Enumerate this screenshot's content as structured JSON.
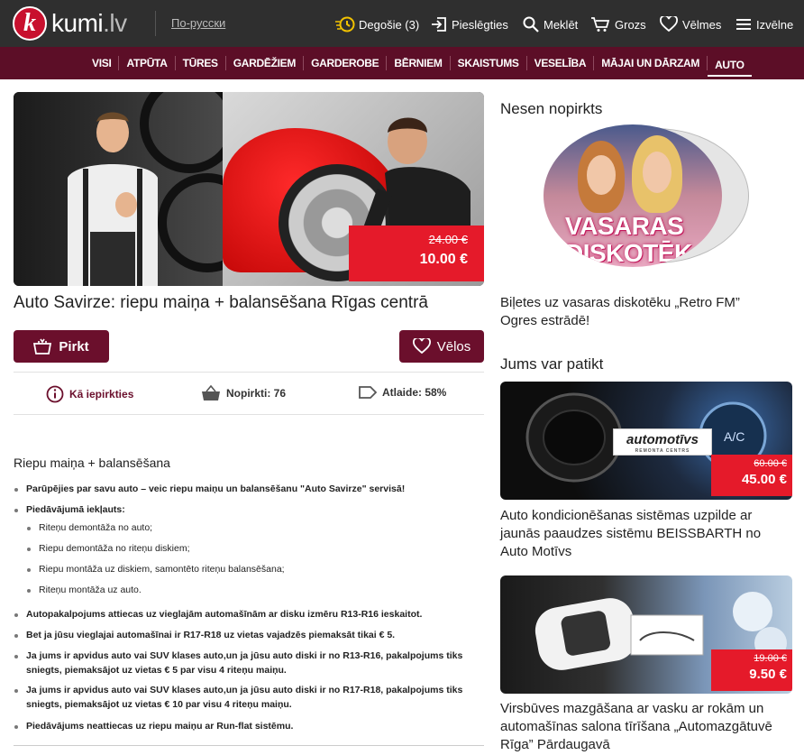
{
  "header": {
    "logo_letter": "k",
    "logo_name": "kumi",
    "logo_tld": ".lv",
    "lang_link": "По-русски",
    "deals_label": "Degošie (3)",
    "login_label": "Pieslēgties",
    "search_label": "Meklēt",
    "cart_label": "Grozs",
    "wishlist_label": "Vēlmes",
    "menu_label": "Izvēlne"
  },
  "nav": {
    "items": [
      "VISI",
      "ATPŪTA",
      "TŪRES",
      "GARDĒŽIEM",
      "GARDEROBE",
      "BĒRNIEM",
      "SKAISTUMS",
      "VESELĪBA",
      "MĀJAI UN DĀRZAM",
      "AUTO"
    ],
    "active": "AUTO"
  },
  "deal": {
    "old_price": "24.00 €",
    "new_price": "10.00 €",
    "title": "Auto Savirze: riepu maiņa + balansēšana Rīgas centrā",
    "buy_label": "Pirkt",
    "wish_label": "Vēlos",
    "how_label": "Kā iepirkties",
    "bought_label": "Nopirkti: 76",
    "discount_label": "Atlaide: 58%"
  },
  "description": {
    "heading": "Riepu maiņa + balansēšana",
    "p1": "Parūpējies par savu auto – veic riepu maiņu un balansēšanu \"Auto Savirze\" servisā!",
    "p2": "Piedāvājumā iekļauts:",
    "s1": "Riteņu demontāža no auto;",
    "s2": "Riepu demontāža no riteņu diskiem;",
    "s3": "Riepu montāža uz diskiem, samontēto riteņu balansēšana;",
    "s4": "Riteņu montāža uz auto.",
    "p3": "Autopakalpojums attiecas uz vieglajām automašīnām ar disku izmēru R13-R16 ieskaitot.",
    "p4": "Bet ja jūsu vieglajai automašīnai ir R17-R18 uz vietas vajadzēs piemaksāt tikai € 5.",
    "p5a": "Ja jums ir apvidus auto vai SUV klases auto,un ja jūsu auto diski ir no R13-R16, pakalpojums tiks",
    "p5b": "sniegts, piemaksājot uz vietas € 5 par visu 4 riteņu maiņu.",
    "p6a": "Ja jums ir apvidus auto vai SUV klases auto,un ja jūsu auto diski ir no R17-R18, pakalpojums tiks",
    "p6b": "sniegts, piemaksājot uz vietas € 10 par visu 4 riteņu maiņu.",
    "p7": "Piedāvājums neattiecas uz riepu maiņu ar Run-flat sistēmu."
  },
  "sidebar": {
    "recent_heading": "Nesen nopirkts",
    "recent_img_text1": "VASARAS",
    "recent_img_text2": "DISKOTĒK",
    "recent_title_1": "Biļetes uz vasaras diskotēku „Retro FM”",
    "recent_title_2": "Ogres estrādē!",
    "like_heading": "Jums var patikt",
    "card1": {
      "logo": "automotīvs",
      "logo_sub": "REMONTA CENTRS",
      "old_price": "60.00 €",
      "new_price": "45.00 €",
      "title_1": "Auto kondicionēšanas sistēmas uzpilde ar",
      "title_2": "jaunās paaudzes sistēmu BEISSBARTH no",
      "title_3": "Auto Motīvs"
    },
    "card2": {
      "old_price": "19.00 €",
      "new_price": "9.50 €",
      "title_1": "Virsbūves mazgāšana ar vasku ar rokām un",
      "title_2": "automašīnas salona tīrīšana „Automazgātuvē",
      "title_3": "Rīga” Pārdaugavā"
    }
  },
  "colors": {
    "brand": "#6b0f2c",
    "nav_bg": "#5c0e27",
    "topbar_bg": "#2f2f2f",
    "price_red": "#e51a2a",
    "deal_icon": "#f2c200"
  }
}
